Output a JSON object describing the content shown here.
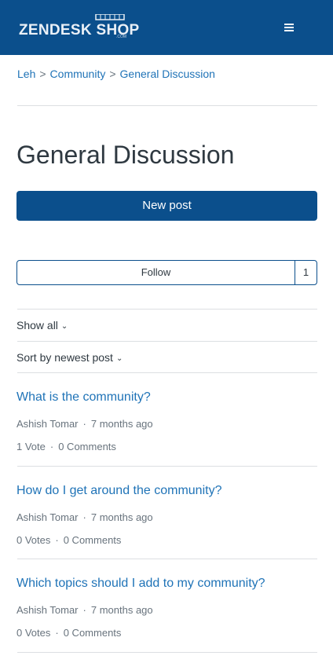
{
  "header": {
    "logo_text": "ZENDESK SHOP",
    "logo_sub": ".COM",
    "menu_icon": "hamburger-menu-icon",
    "bg_color": "#0b4f8c"
  },
  "breadcrumb": [
    "Leh",
    "Community",
    "General Discussion"
  ],
  "breadcrumb_separator": ">",
  "page_title": "General Discussion",
  "new_post_label": "New post",
  "follow": {
    "label": "Follow",
    "count": "1"
  },
  "filters": {
    "show_label": "Show all",
    "sort_label": "Sort by newest post",
    "chevron_icon": "chevron-down-icon"
  },
  "posts": [
    {
      "title": "What is the community?",
      "author": "Ashish Tomar",
      "time": "7 months ago",
      "votes": "1 Vote",
      "comments": "0 Comments"
    },
    {
      "title": "How do I get around the community?",
      "author": "Ashish Tomar",
      "time": "7 months ago",
      "votes": "0 Votes",
      "comments": "0 Comments"
    },
    {
      "title": "Which topics should I add to my community?",
      "author": "Ashish Tomar",
      "time": "7 months ago",
      "votes": "0 Votes",
      "comments": "0 Comments"
    }
  ],
  "meta_separator": "·",
  "colors": {
    "accent": "#0b4f8c",
    "link": "#1f73b7",
    "muted": "#68737d"
  }
}
